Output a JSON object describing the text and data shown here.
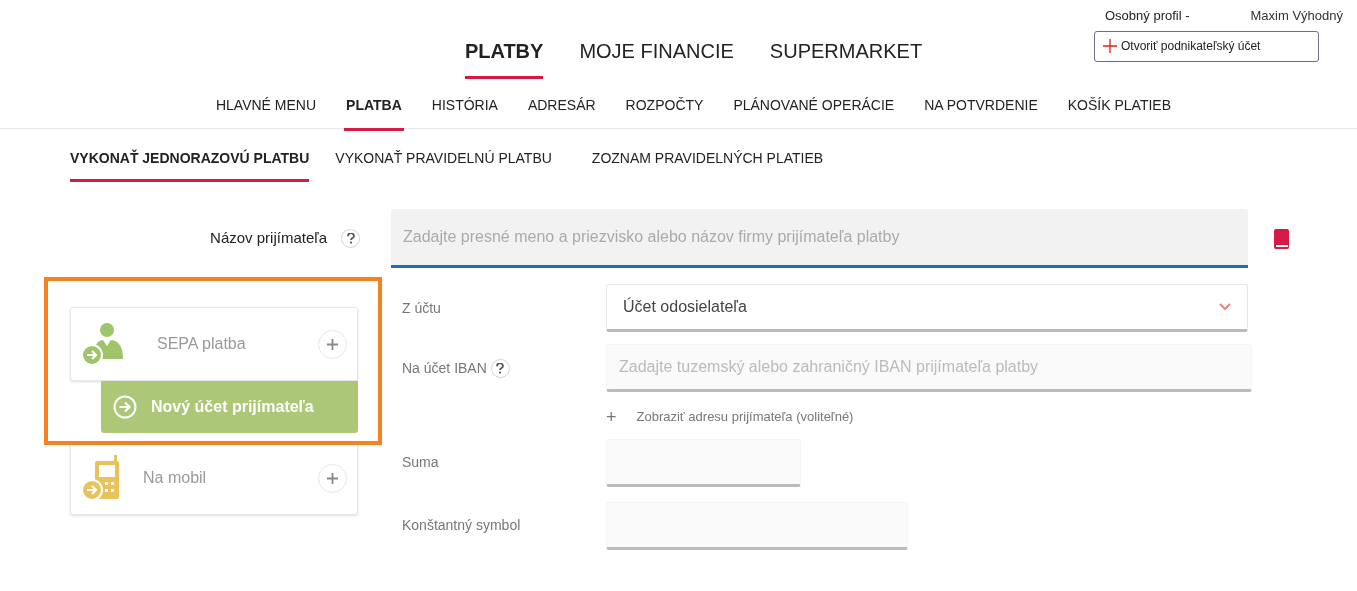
{
  "profile": {
    "label": "Osobný profil",
    "separator": "-",
    "user": "Maxim Výhodný",
    "open_business_button": "Otvoriť podnikateľský účet"
  },
  "main_nav": [
    {
      "label": "PLATBY",
      "selected": true
    },
    {
      "label": "MOJE FINANCIE",
      "selected": false
    },
    {
      "label": "SUPERMARKET",
      "selected": false
    }
  ],
  "sub_nav": [
    {
      "label": "HLAVNÉ MENU",
      "selected": false
    },
    {
      "label": "PLATBA",
      "selected": true
    },
    {
      "label": "HISTÓRIA",
      "selected": false
    },
    {
      "label": "ADRESÁR",
      "selected": false
    },
    {
      "label": "ROZPOČTY",
      "selected": false
    },
    {
      "label": "PLÁNOVANÉ OPERÁCIE",
      "selected": false
    },
    {
      "label": "NA POTVRDENIE",
      "selected": false
    },
    {
      "label": "KOŠÍK PLATIEB",
      "selected": false
    }
  ],
  "tabs": [
    {
      "label": "VYKONAŤ JEDNORAZOVÚ PLATBU",
      "selected": true
    },
    {
      "label": "VYKONAŤ PRAVIDELNÚ PLATBU",
      "selected": false
    },
    {
      "label": "ZOZNAM PRAVIDELNÝCH PLATIEB",
      "selected": false
    }
  ],
  "recipient": {
    "label": "Názov prijímateľa",
    "placeholder": "Zadajte presné meno a priezvisko alebo názov firmy prijímateľa platby"
  },
  "payment_types": [
    {
      "kind": "person",
      "label": "SEPA platba",
      "expanded": true,
      "action": "Nový účet prijímateľa"
    },
    {
      "kind": "mobile",
      "label": "Na mobil",
      "expanded": false
    }
  ],
  "highlight": true,
  "form": {
    "from_account": {
      "label": "Z účtu",
      "value": "Účet odosielateľa"
    },
    "iban": {
      "label": "Na účet IBAN",
      "placeholder": "Zadajte tuzemský alebo zahraničný IBAN prijímateľa platby"
    },
    "address_toggle": {
      "icon": "+",
      "label": "Zobraziť adresu prijímateľa (voliteľné)"
    },
    "amount": {
      "label": "Suma"
    },
    "constant_symbol": {
      "label": "Konštantný symbol"
    }
  }
}
